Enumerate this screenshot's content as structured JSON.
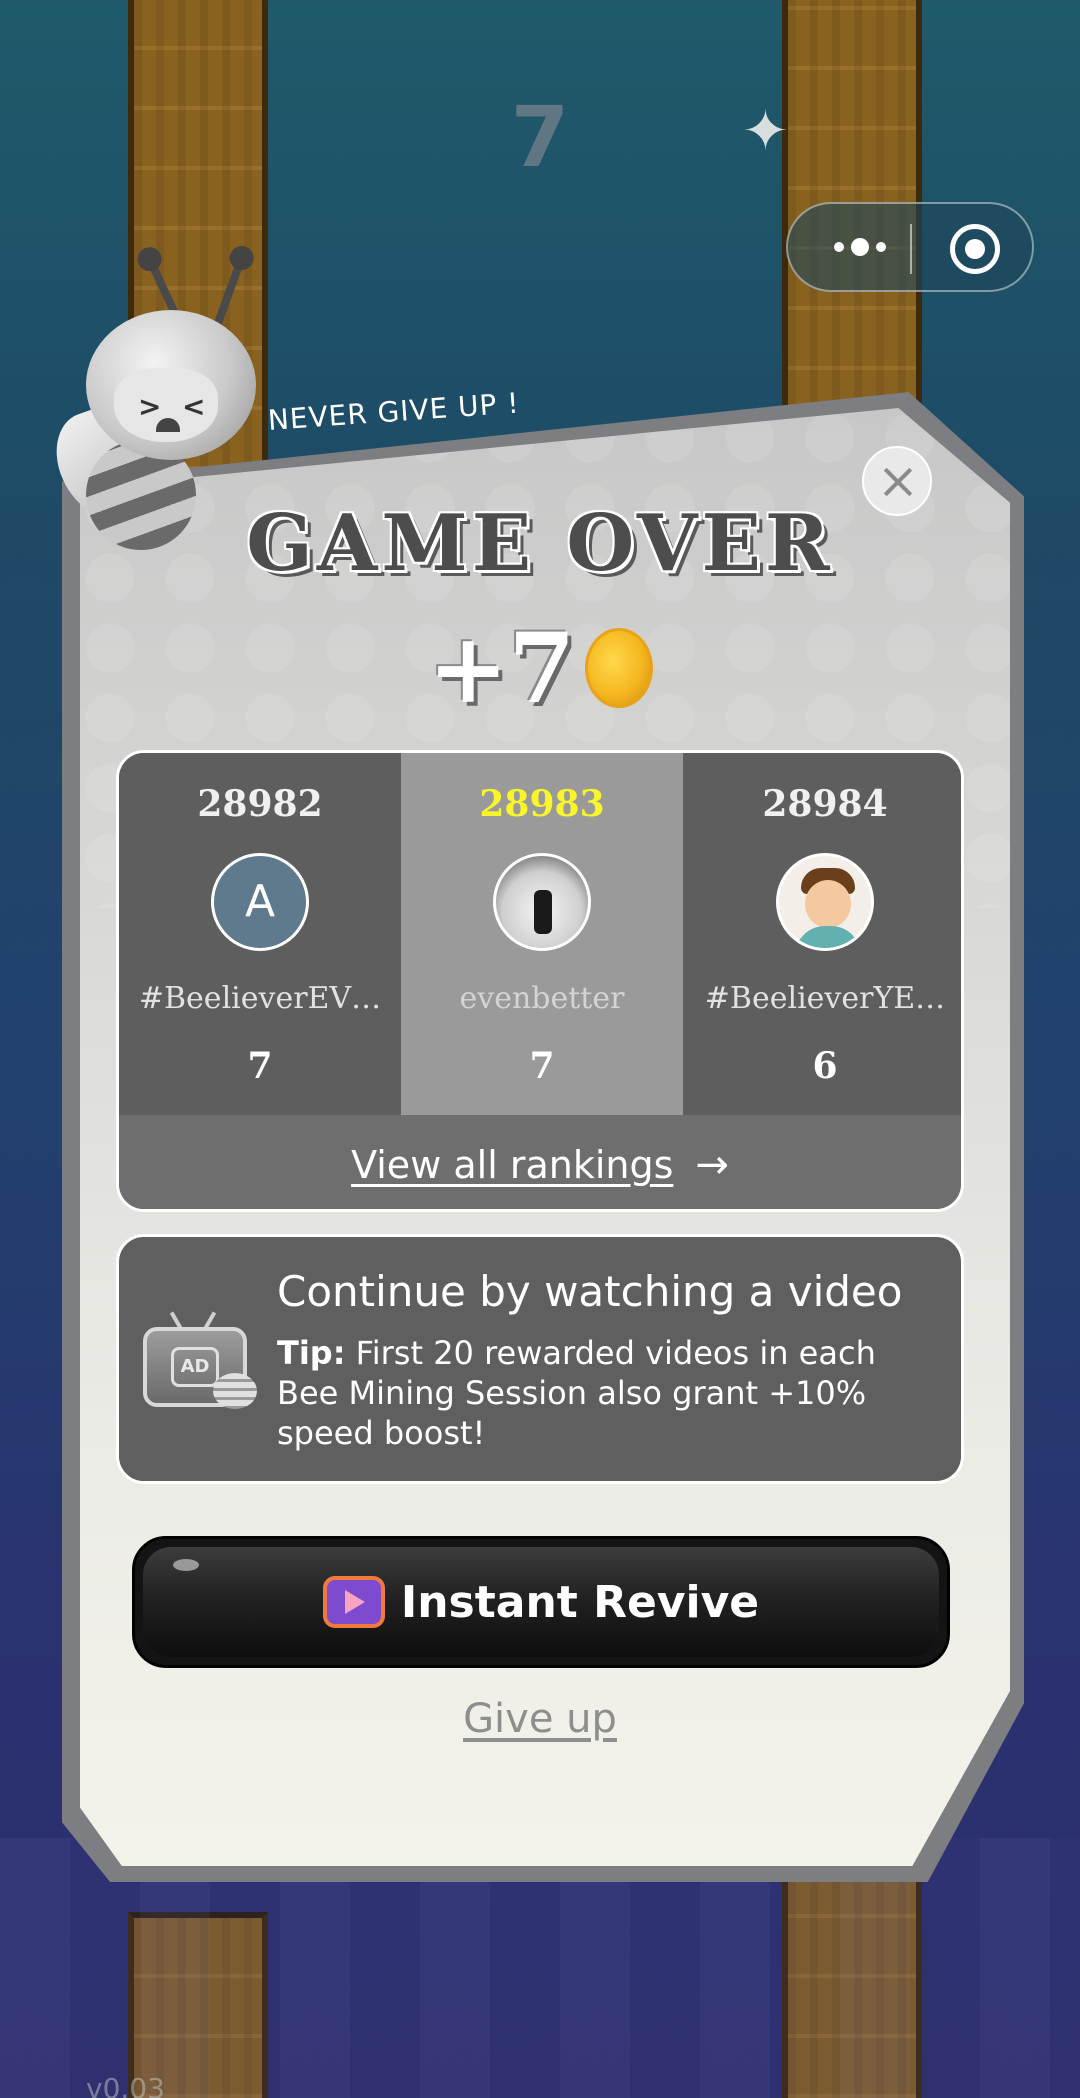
{
  "background": {
    "score": "7",
    "version": "v0.03"
  },
  "capsule": {
    "more_icon": "more-dots-icon",
    "close_icon": "target-circle-icon"
  },
  "modal": {
    "banner": "NEVER GIVE UP  !",
    "title": "GAME OVER",
    "reward_amount": "+7",
    "reward_icon": "coin-icon",
    "rankings": [
      {
        "rank": "28982",
        "avatar_letter": "A",
        "name": "#BeelieverEV…",
        "score": "7"
      },
      {
        "rank": "28983",
        "avatar_letter": "",
        "name": "evenbetter",
        "score": "7",
        "highlight_color": "#f8f62a"
      },
      {
        "rank": "28984",
        "avatar_letter": "",
        "name": "#BeelieverYE…",
        "score": "6"
      }
    ],
    "view_all_label": "View all rankings",
    "view_all_arrow": "→",
    "continue": {
      "title": "Continue by watching a video",
      "tip_label": "Tip:",
      "tip_text": " First 20 rewarded videos in each Bee Mining Session also grant +10% speed boost!",
      "icon": "ad-tv-icon"
    },
    "revive_label": "Instant Revive",
    "give_up_label": "Give up"
  }
}
